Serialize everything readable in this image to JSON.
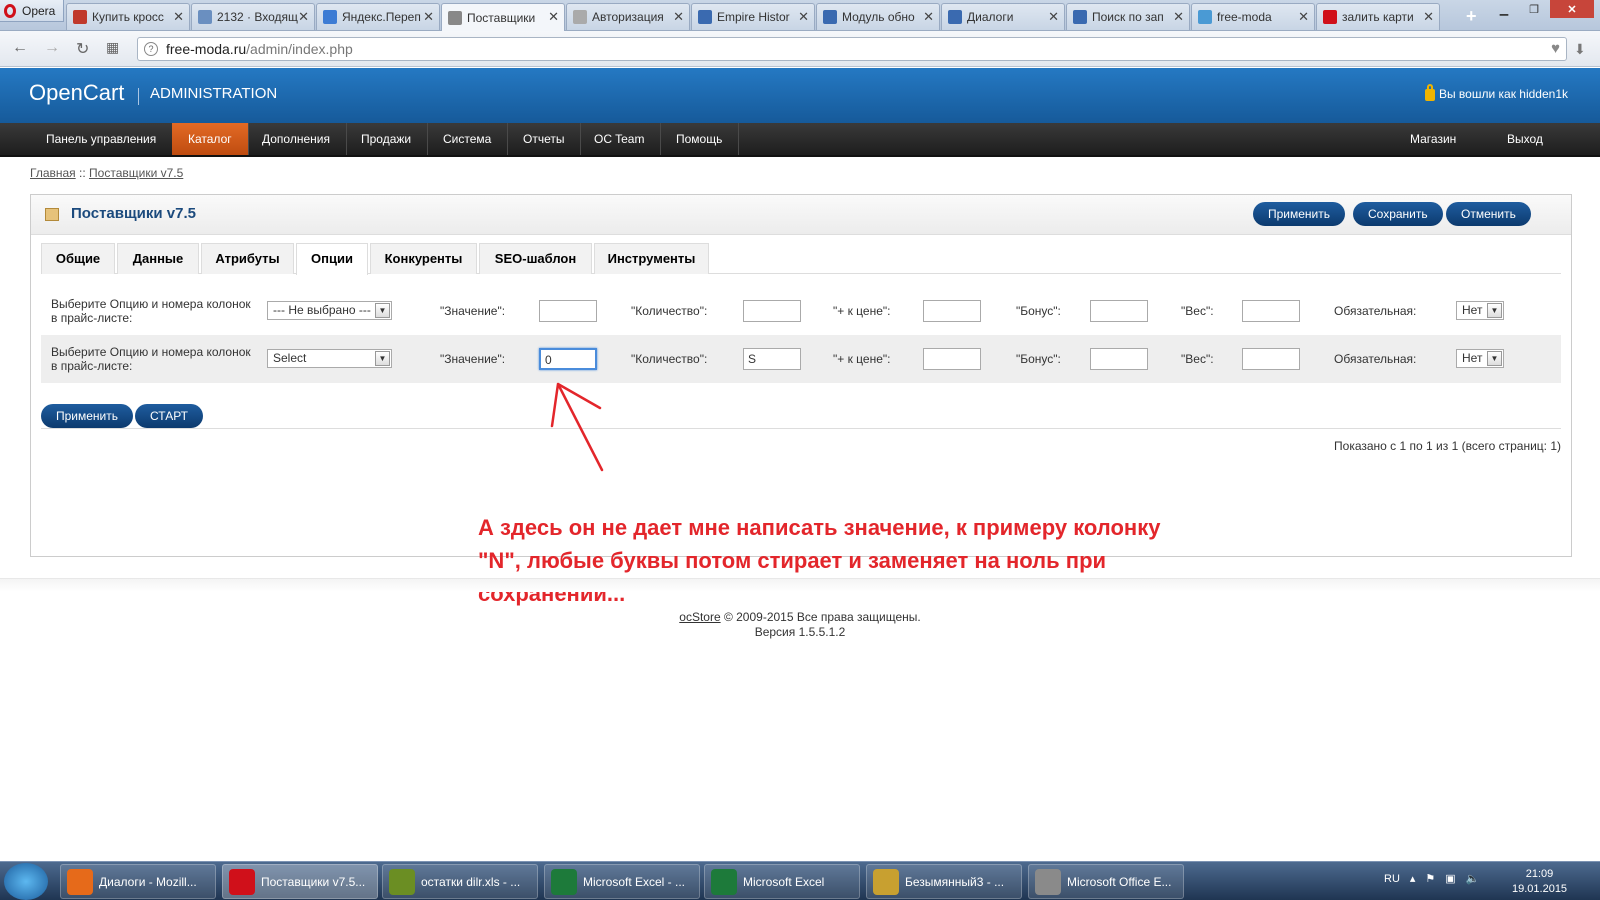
{
  "browser": {
    "menu_label": "Opera",
    "tabs": [
      {
        "title": "Купить кросс",
        "color": "#c0392b"
      },
      {
        "title": "2132 · Входящ",
        "color": "#6a8fc0"
      },
      {
        "title": "Яндекс.Переп",
        "color": "#3d7cd4"
      },
      {
        "title": "Поставщики",
        "color": "#888888"
      },
      {
        "title": "Авторизация",
        "color": "#aaaaaa"
      },
      {
        "title": "Empire Histor",
        "color": "#3a6ab0"
      },
      {
        "title": "Модуль обно",
        "color": "#3a6ab0"
      },
      {
        "title": "Диалоги",
        "color": "#3a6ab0"
      },
      {
        "title": "Поиск по зап",
        "color": "#3a6ab0"
      },
      {
        "title": "free-moda",
        "color": "#4a9ad4"
      },
      {
        "title": "залить карти",
        "color": "#d0101a"
      }
    ],
    "active_tab": 3,
    "url_host": "free-moda.ru",
    "url_path": "/admin/index.php"
  },
  "header": {
    "logo": "OpenCart",
    "admin_label": "ADMINISTRATION",
    "user_text": "Вы вошли как hidden1k"
  },
  "menu": {
    "items": [
      "Панель управления",
      "Каталог",
      "Дополнения",
      "Продажи",
      "Система",
      "Отчеты",
      "OC Team",
      "Помощь"
    ],
    "right_items": [
      "Магазин",
      "Выход"
    ],
    "active": "Каталог"
  },
  "breadcrumb": {
    "home": "Главная",
    "sep": " :: ",
    "current": "Поставщики v7.5"
  },
  "panel": {
    "title": "Поставщики v7.5",
    "buttons": {
      "apply": "Применить",
      "save": "Сохранить",
      "cancel": "Отменить"
    },
    "tabs": [
      "Общие",
      "Данные",
      "Атрибуты",
      "Опции",
      "Конкуренты",
      "SEO-шаблон",
      "Инструменты"
    ],
    "active_tab": "Опции",
    "rows": [
      {
        "label": "Выберите Опцию и номера колонок в прайс-листе:",
        "select": "--- Не выбрано ---",
        "value_label": "\"Значение\":",
        "value": "",
        "qty_label": "\"Количество\":",
        "qty": "",
        "price_label": "\"+ к цене\":",
        "price": "",
        "bonus_label": "\"Бонус\":",
        "bonus": "",
        "weight_label": "\"Вес\":",
        "weight": "",
        "required_label": "Обязательная:",
        "required": "Нет"
      },
      {
        "label": "Выберите Опцию и номера колонок в прайс-листе:",
        "select": "Select",
        "value_label": "\"Значение\":",
        "value": "0",
        "qty_label": "\"Количество\":",
        "qty": "S",
        "price_label": "\"+ к цене\":",
        "price": "",
        "bonus_label": "\"Бонус\":",
        "bonus": "",
        "weight_label": "\"Вес\":",
        "weight": "",
        "required_label": "Обязательная:",
        "required": "Нет"
      }
    ],
    "bottom_buttons": {
      "apply": "Применить",
      "start": "СТАРТ"
    },
    "pager": "Показано с 1 по 1 из 1 (всего страниц: 1)"
  },
  "annotation": {
    "text": "А здесь он не дает мне написать значение, к примеру колонку \"N\", любые буквы потом стирает и заменяет на ноль при сохранении...",
    "color": "#e3262b"
  },
  "footer": {
    "link": "ocStore",
    "copyright": " © 2009-2015 Все права защищены.",
    "version": "Версия 1.5.5.1.2"
  },
  "taskbar": {
    "items": [
      {
        "label": "Диалоги - Mozill...",
        "color": "#e66a1a"
      },
      {
        "label": "Поставщики v7.5...",
        "color": "#d0101a"
      },
      {
        "label": "остатки dilr.xls - ...",
        "color": "#6b8e23"
      },
      {
        "label": "Microsoft Excel - ...",
        "color": "#1d7a3a"
      },
      {
        "label": "Microsoft Excel",
        "color": "#1d7a3a"
      },
      {
        "label": "Безымянный3 - ...",
        "color": "#c8a030"
      },
      {
        "label": "Microsoft Office E...",
        "color": "#8a8a8a"
      }
    ],
    "lang": "RU",
    "time": "21:09",
    "date": "19.01.2015"
  }
}
